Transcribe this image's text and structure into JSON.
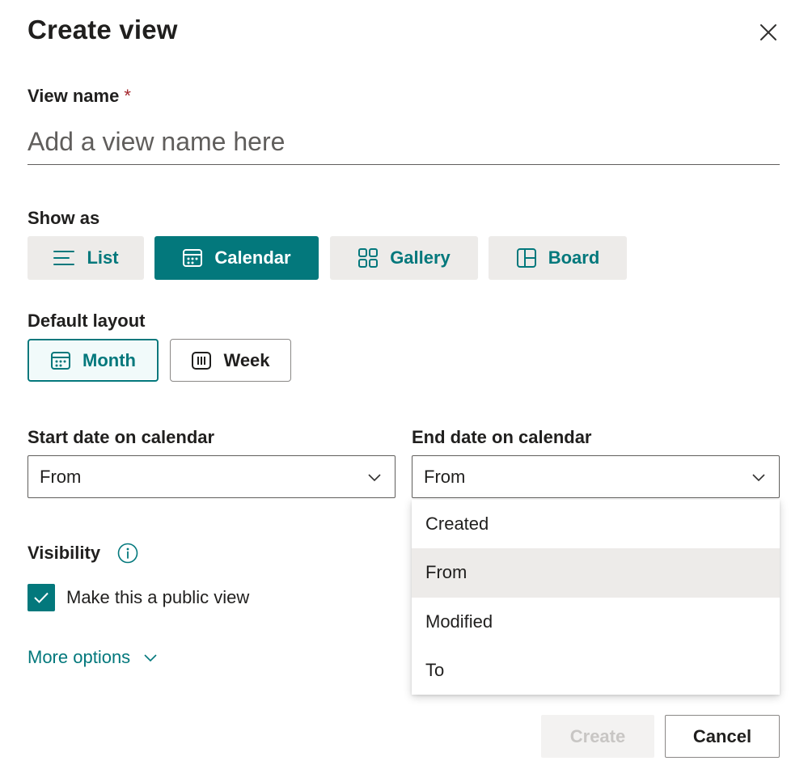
{
  "dialog": {
    "title": "Create view",
    "close_icon": "close-icon"
  },
  "view_name": {
    "label": "View name",
    "required_marker": "*",
    "placeholder": "Add a view name here",
    "value": ""
  },
  "show_as": {
    "label": "Show as",
    "options": [
      {
        "label": "List",
        "icon": "list-icon",
        "selected": false
      },
      {
        "label": "Calendar",
        "icon": "calendar-icon",
        "selected": true
      },
      {
        "label": "Gallery",
        "icon": "gallery-icon",
        "selected": false
      },
      {
        "label": "Board",
        "icon": "board-icon",
        "selected": false
      }
    ]
  },
  "default_layout": {
    "label": "Default layout",
    "options": [
      {
        "label": "Month",
        "icon": "calendar-month-icon",
        "selected": true
      },
      {
        "label": "Week",
        "icon": "calendar-week-icon",
        "selected": false
      }
    ]
  },
  "start_date": {
    "label": "Start date on calendar",
    "value": "From"
  },
  "end_date": {
    "label": "End date on calendar",
    "value": "From",
    "open": true,
    "options": [
      "Created",
      "From",
      "Modified",
      "To"
    ],
    "highlighted": "From"
  },
  "visibility": {
    "label": "Visibility",
    "info_icon": "info-icon",
    "public_checkbox_label": "Make this a public view",
    "public_checked": true
  },
  "more_options": {
    "label": "More options",
    "icon": "chevron-down-icon"
  },
  "footer": {
    "create_label": "Create",
    "create_disabled": true,
    "cancel_label": "Cancel"
  },
  "colors": {
    "accent": "#03787c",
    "required": "#a4262c",
    "neutral_bg": "#edebe9",
    "disabled_bg": "#f3f2f1",
    "disabled_text": "#c8c6c4"
  }
}
